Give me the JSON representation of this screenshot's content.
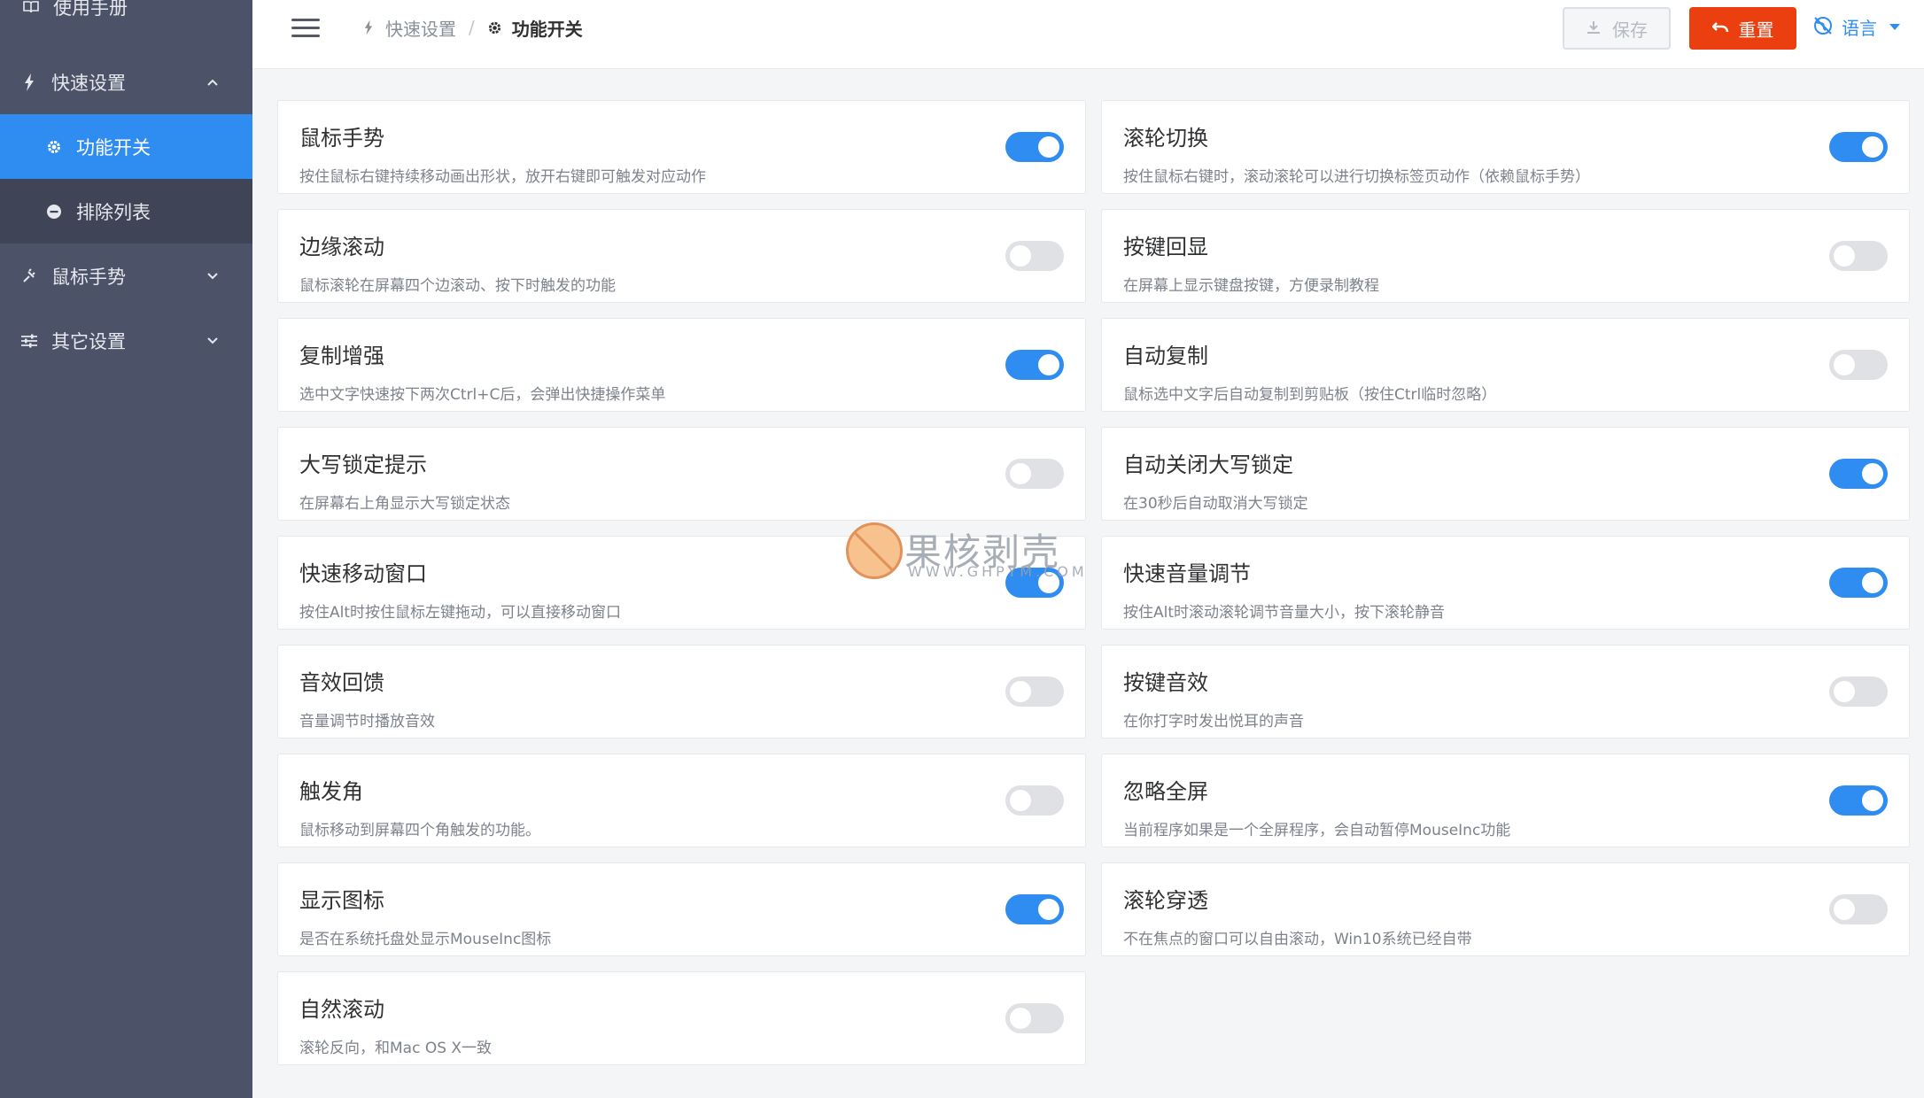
{
  "sidebar": {
    "manual": "使用手册",
    "quick_settings": "快速设置",
    "feature_toggles": "功能开关",
    "exclusion_list": "排除列表",
    "mouse_gestures": "鼠标手势",
    "other_settings": "其它设置"
  },
  "header": {
    "breadcrumb_parent": "快速设置",
    "breadcrumb_separator": "/",
    "breadcrumb_current": "功能开关",
    "save_label": "保存",
    "reset_label": "重置",
    "language_label": "语言"
  },
  "features": [
    {
      "title": "鼠标手势",
      "desc": "按住鼠标右键持续移动画出形状，放开右键即可触发对应动作",
      "enabled": true
    },
    {
      "title": "滚轮切换",
      "desc": "按住鼠标右键时，滚动滚轮可以进行切换标签页动作（依赖鼠标手势）",
      "enabled": true
    },
    {
      "title": "边缘滚动",
      "desc": "鼠标滚轮在屏幕四个边滚动、按下时触发的功能",
      "enabled": false
    },
    {
      "title": "按键回显",
      "desc": "在屏幕上显示键盘按键，方便录制教程",
      "enabled": false
    },
    {
      "title": "复制增强",
      "desc": "选中文字快速按下两次Ctrl+C后，会弹出快捷操作菜单",
      "enabled": true
    },
    {
      "title": "自动复制",
      "desc": "鼠标选中文字后自动复制到剪贴板（按住Ctrl临时忽略）",
      "enabled": false
    },
    {
      "title": "大写锁定提示",
      "desc": "在屏幕右上角显示大写锁定状态",
      "enabled": false
    },
    {
      "title": "自动关闭大写锁定",
      "desc": "在30秒后自动取消大写锁定",
      "enabled": true
    },
    {
      "title": "快速移动窗口",
      "desc": "按住Alt时按住鼠标左键拖动，可以直接移动窗口",
      "enabled": true
    },
    {
      "title": "快速音量调节",
      "desc": "按住Alt时滚动滚轮调节音量大小，按下滚轮静音",
      "enabled": true
    },
    {
      "title": "音效回馈",
      "desc": "音量调节时播放音效",
      "enabled": false
    },
    {
      "title": "按键音效",
      "desc": "在你打字时发出悦耳的声音",
      "enabled": false
    },
    {
      "title": "触发角",
      "desc": "鼠标移动到屏幕四个角触发的功能。",
      "enabled": false
    },
    {
      "title": "忽略全屏",
      "desc": "当前程序如果是一个全屏程序，会自动暂停MouseInc功能",
      "enabled": true
    },
    {
      "title": "显示图标",
      "desc": "是否在系统托盘处显示MouseInc图标",
      "enabled": true
    },
    {
      "title": "滚轮穿透",
      "desc": "不在焦点的窗口可以自由滚动，Win10系统已经自带",
      "enabled": false
    },
    {
      "title": "自然滚动",
      "desc": "滚轮反向，和Mac OS X一致",
      "enabled": false
    }
  ],
  "watermark": {
    "text": "果核剥壳",
    "url": "WWW.GHPYM.COM"
  },
  "colors": {
    "sidebar_bg": "#4c5368",
    "accent": "#2f8cf0",
    "reset_bg": "#ec3f0f",
    "switch_off": "#dfe1e5"
  }
}
